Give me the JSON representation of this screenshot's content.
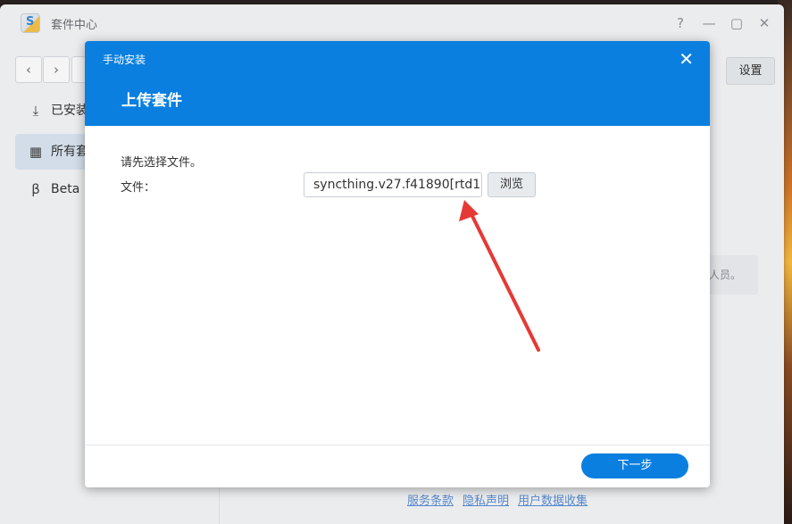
{
  "window": {
    "title": "套件中心",
    "app_icon_letter": "S",
    "controls": {
      "help": "?",
      "minimize": "—",
      "maximize": "▢",
      "close": "✕"
    }
  },
  "toolbar": {
    "back": "‹",
    "forward": "›",
    "settings_label": "设置"
  },
  "sidebar": {
    "items": [
      {
        "label": "已安装",
        "icon": "download-icon",
        "glyph": "⤓",
        "active": false
      },
      {
        "label": "所有套",
        "icon": "grid-icon",
        "glyph": "▦",
        "active": true
      },
      {
        "label": "Beta",
        "icon": "beta-icon",
        "glyph": "β",
        "active": false
      }
    ]
  },
  "background_hint": "人员。",
  "footer": {
    "links": [
      "服务条款",
      "隐私声明",
      "用户数据收集"
    ]
  },
  "dialog": {
    "small_title": "手动安装",
    "close_glyph": "✕",
    "big_title": "上传套件",
    "prompt": "请先选择文件。",
    "file_label": "文件：",
    "file_value": "syncthing.v27.f41890[rtd1",
    "browse_label": "浏览",
    "next_label": "下一步"
  },
  "colors": {
    "accent": "#0a7fe0",
    "annotation_arrow": "#e53935"
  }
}
